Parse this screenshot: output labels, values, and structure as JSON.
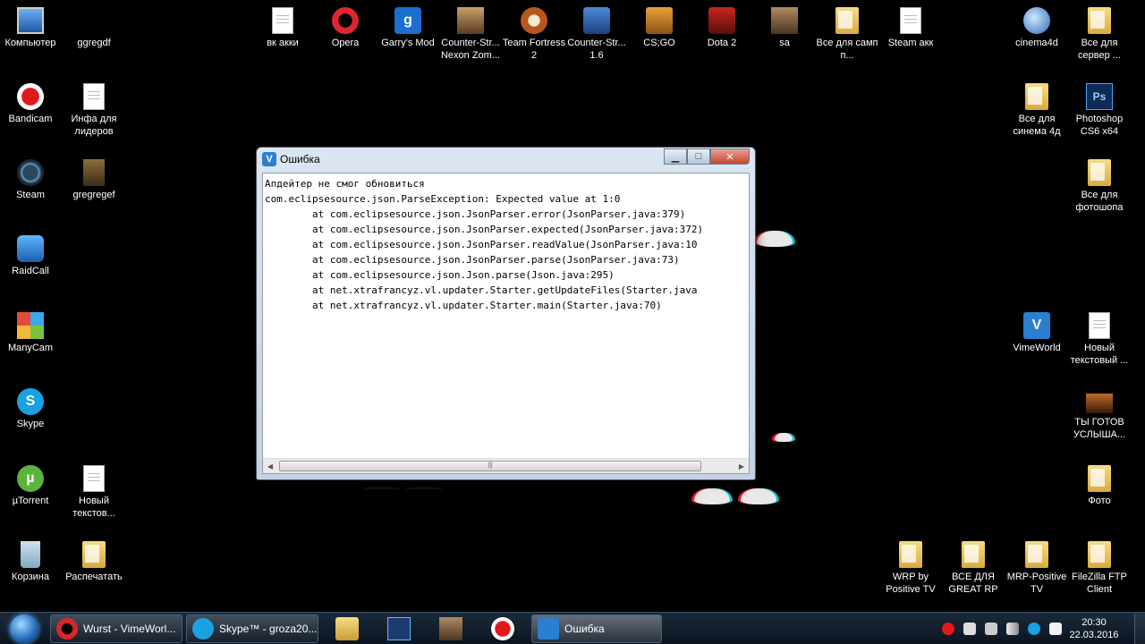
{
  "desktop": {
    "icons": [
      {
        "label": "Компьютер",
        "icon": "computer-icon"
      },
      {
        "label": "ggregdf",
        "icon": "shortcut-icon"
      },
      {
        "label": "вк акки",
        "icon": "text-file-icon"
      },
      {
        "label": "Opera",
        "icon": "opera-icon"
      },
      {
        "label": "Garry's Mod",
        "icon": "garrys-mod-icon"
      },
      {
        "label": "Counter-Str... Nexon Zom...",
        "icon": "counter-strike-nexon-icon"
      },
      {
        "label": "Team Fortress 2",
        "icon": "team-fortress-icon"
      },
      {
        "label": "Counter-Str... 1.6",
        "icon": "counter-strike-icon"
      },
      {
        "label": "CS;GO",
        "icon": "csgo-icon"
      },
      {
        "label": "Dota 2",
        "icon": "dota-icon"
      },
      {
        "label": "sa",
        "icon": "gta-sa-icon"
      },
      {
        "label": "Все для самп п...",
        "icon": "folder-icon"
      },
      {
        "label": "Steam акк",
        "icon": "text-file-icon"
      },
      {
        "label": "cinema4d",
        "icon": "cinema4d-icon"
      },
      {
        "label": "Все для сервер ...",
        "icon": "folder-icon"
      },
      {
        "label": "Bandicam",
        "icon": "bandicam-icon"
      },
      {
        "label": "Инфа для лидеров",
        "icon": "text-file-icon"
      },
      {
        "label": "Все для синема 4д",
        "icon": "folder-icon"
      },
      {
        "label": "Photoshop CS6 x64",
        "icon": "photoshop-icon"
      },
      {
        "label": "Steam",
        "icon": "steam-icon"
      },
      {
        "label": "gregregef",
        "icon": "image-file-icon"
      },
      {
        "label": "Все для фотошопа",
        "icon": "folder-icon"
      },
      {
        "label": "RaidCall",
        "icon": "raidcall-icon"
      },
      {
        "label": "ManyCam",
        "icon": "manycam-icon"
      },
      {
        "label": "VimeWorld",
        "icon": "vimeworld-icon"
      },
      {
        "label": "Новый текстовый ...",
        "icon": "text-file-icon"
      },
      {
        "label": "Skype",
        "icon": "skype-icon"
      },
      {
        "label": "ТЫ ГОТОВ УСЛЫША...",
        "icon": "video-file-icon"
      },
      {
        "label": "µTorrent",
        "icon": "utorrent-icon"
      },
      {
        "label": "Новый текстов...",
        "icon": "text-file-icon"
      },
      {
        "label": "Фото",
        "icon": "folder-icon"
      },
      {
        "label": "Корзина",
        "icon": "recycle-bin-icon"
      },
      {
        "label": "Распечатать",
        "icon": "folder-icon"
      },
      {
        "label": "WRP by Positive TV",
        "icon": "folder-icon"
      },
      {
        "label": "ВСЕ ДЛЯ GREAT RP",
        "icon": "folder-icon"
      },
      {
        "label": "MRP-Positive TV",
        "icon": "folder-icon"
      },
      {
        "label": "FileZilla FTP Client",
        "icon": "folder-icon"
      }
    ]
  },
  "error_window": {
    "title": "Ошибка",
    "minimize": "▁",
    "maximize": "□",
    "close": "✕",
    "message_lines": [
      "Апдейтер не смог обновиться",
      "com.eclipsesource.json.ParseException: Expected value at 1:0",
      "        at com.eclipsesource.json.JsonParser.error(JsonParser.java:379)",
      "        at com.eclipsesource.json.JsonParser.expected(JsonParser.java:372)",
      "        at com.eclipsesource.json.JsonParser.readValue(JsonParser.java:10",
      "        at com.eclipsesource.json.JsonParser.parse(JsonParser.java:73)",
      "        at com.eclipsesource.json.Json.parse(Json.java:295)",
      "        at net.xtrafrancyz.vl.updater.Starter.getUpdateFiles(Starter.java",
      "        at net.xtrafrancyz.vl.updater.Starter.main(Starter.java:70)"
    ],
    "scroll_left": "◀",
    "scroll_right": "▶",
    "scroll_grip": "|||"
  },
  "taskbar": {
    "buttons": [
      {
        "label": "Wurst - VimeWorl...",
        "icon": "opera-icon",
        "color": "#d8262c"
      },
      {
        "label": "Skype™ - groza20...",
        "icon": "skype-icon",
        "color": "#1aa1e1"
      },
      {
        "label": "Ошибка",
        "icon": "vimeworld-icon",
        "color": "#2a7fd0"
      }
    ],
    "pinned": [
      {
        "icon": "explorer-icon",
        "color": "#e8c45a"
      },
      {
        "icon": "photoshop-icon",
        "color": "#1b3b72"
      },
      {
        "icon": "gta-sa-icon",
        "color": "#8a6a4a"
      },
      {
        "icon": "bandicam-icon",
        "color": "#e01a1a"
      }
    ],
    "tray_icons": [
      "bandicam-tray-icon",
      "volume-icon",
      "network-icon",
      "signal-icon",
      "app-tray-icon",
      "flag-icon"
    ],
    "time": "20:30",
    "date": "22.03.2016"
  }
}
